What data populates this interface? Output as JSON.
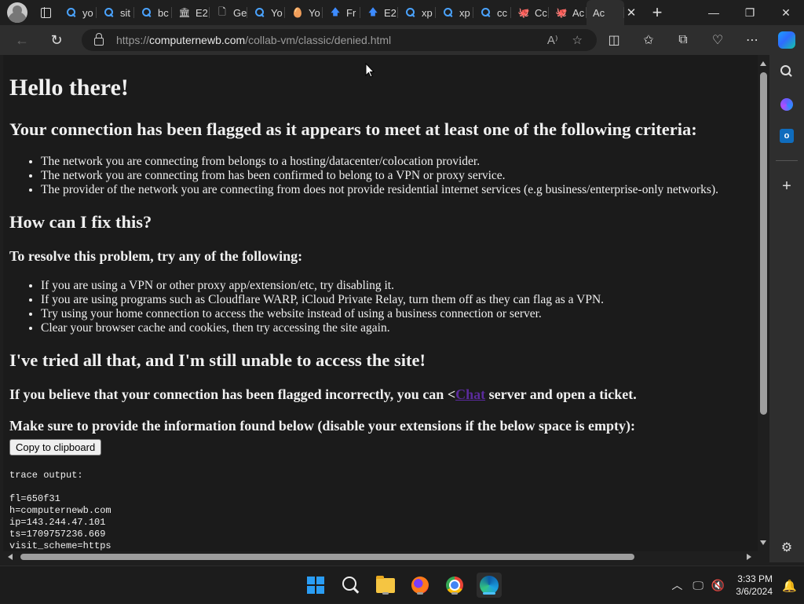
{
  "browser": {
    "tabs": [
      {
        "label": "yo",
        "icon": "search-icon"
      },
      {
        "label": "sit",
        "icon": "search-icon"
      },
      {
        "label": "bc",
        "icon": "search-icon"
      },
      {
        "label": "E2",
        "icon": "bank-icon"
      },
      {
        "label": "Ge",
        "icon": "document-icon"
      },
      {
        "label": "Yo",
        "icon": "search-icon"
      },
      {
        "label": "Yo",
        "icon": "egg-icon"
      },
      {
        "label": "Fr",
        "icon": "arrow-up-icon"
      },
      {
        "label": "E2",
        "icon": "arrow-up-icon"
      },
      {
        "label": "xp",
        "icon": "search-icon"
      },
      {
        "label": "xp",
        "icon": "search-icon"
      },
      {
        "label": "cc",
        "icon": "search-icon"
      },
      {
        "label": "Cc",
        "icon": "github-icon"
      },
      {
        "label": "Ac",
        "icon": "github-icon"
      },
      {
        "label": "Ac",
        "icon": "",
        "active": true
      }
    ],
    "url_scheme": "https://",
    "url_host": "computernewb.com",
    "url_path": "/collab-vm/classic/denied.html"
  },
  "page": {
    "heading": "Hello there!",
    "flag_heading": "Your connection has been flagged as it appears to meet at least one of the following criteria:",
    "criteria": [
      "The network you are connecting from belongs to a hosting/datacenter/colocation provider.",
      "The network you are connecting from has been confirmed to belong to a VPN or proxy service.",
      "The provider of the network you are connecting from does not provide residential internet services (e.g business/enterprise-only networks)."
    ],
    "fix_heading": "How can I fix this?",
    "resolve_heading": "To resolve this problem, try any of the following:",
    "fixes": [
      "If you are using a VPN or other proxy app/extension/etc, try disabling it.",
      "If you are using programs such as Cloudflare WARP, iCloud Private Relay, turn them off as they can flag as a VPN.",
      "Try using your home connection to access the website instead of using a business connection or server.",
      "Clear your browser cache and cookies, then try accessing the site again."
    ],
    "still_heading": "I've tried all that, and I'm still unable to access the site!",
    "believe_before": "If you believe that your connection has been flagged incorrectly, you can <",
    "chat_link": "Chat",
    "believe_after": " server and open a ticket.",
    "provide_heading": "Make sure to provide the information found below (disable your extensions if the below space is empty):",
    "copy_button": "Copy to clipboard",
    "trace_label": "trace output:",
    "trace_lines": [
      "fl=650f31",
      "h=computernewb.com",
      "ip=143.244.47.101",
      "ts=1709757236.669",
      "visit_scheme=https"
    ]
  },
  "taskbar": {
    "time": "3:33 PM",
    "date": "3/6/2024"
  },
  "colors": {
    "accent": "#4cc2ff",
    "link_visited": "#5b2b9d"
  }
}
